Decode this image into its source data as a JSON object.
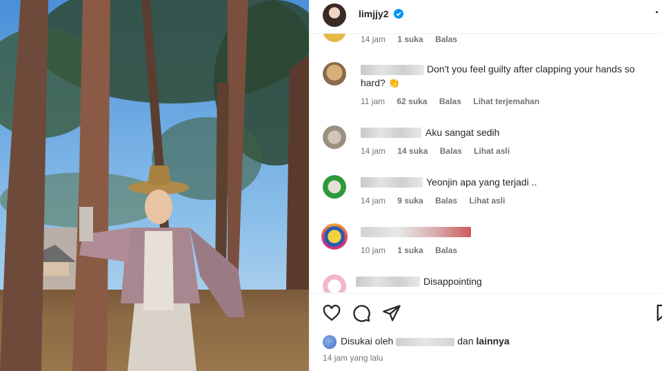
{
  "post": {
    "username": "limjjy2",
    "verified": true,
    "more_icon": "ellipsis-icon"
  },
  "comments": [
    {
      "text": "",
      "time": "14 jam",
      "likes": "1 suka",
      "reply": "Balas",
      "translate": ""
    },
    {
      "text": "Don't you feel guilty after clapping your hands so hard? 👏",
      "time": "11 jam",
      "likes": "62 suka",
      "reply": "Balas",
      "translate": "Lihat terjemahan"
    },
    {
      "text": "Aku sangat sedih",
      "time": "14 jam",
      "likes": "14 suka",
      "reply": "Balas",
      "translate": "Lihat asli"
    },
    {
      "text": "Yeonjin apa yang terjadi ..",
      "time": "14 jam",
      "likes": "9 suka",
      "reply": "Balas",
      "translate": "Lihat asli"
    },
    {
      "text": "",
      "time": "10 jam",
      "likes": "1 suka",
      "reply": "Balas",
      "translate": ""
    },
    {
      "text": "Disappointing",
      "time": "",
      "likes": "",
      "reply": "",
      "translate": ""
    }
  ],
  "actions": {
    "like_icon": "heart-icon",
    "comment_icon": "comment-icon",
    "share_icon": "share-icon",
    "save_icon": "bookmark-icon"
  },
  "likes": {
    "prefix": "Disukai oleh",
    "middle": "dan",
    "others": "lainnya"
  },
  "timestamp": "14 jam yang lalu",
  "colors": {
    "verified": "#0095f6",
    "muted": "#737373",
    "text": "#262626"
  }
}
